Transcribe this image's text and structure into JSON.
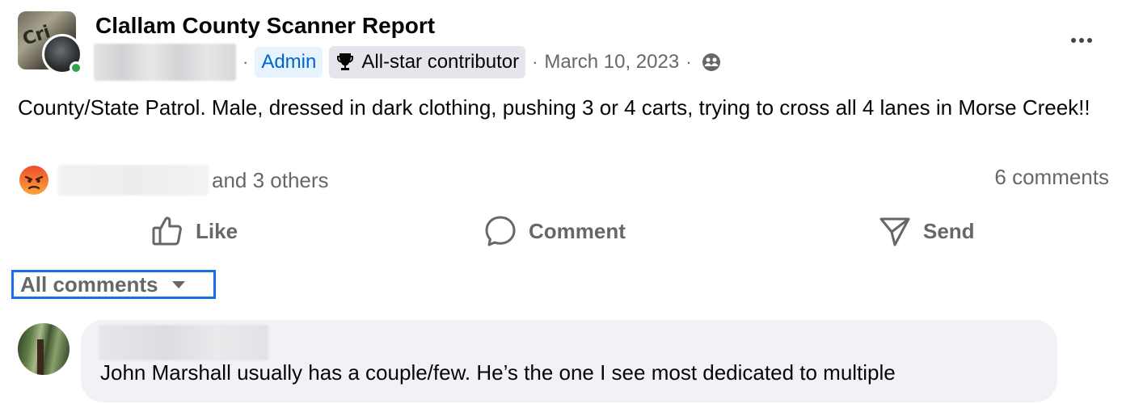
{
  "post": {
    "group_name": "Clallam County Scanner Report",
    "author_badges": {
      "admin": "Admin",
      "contributor": "All-star contributor"
    },
    "date": "March 10, 2023",
    "separator": "·",
    "text": "County/State Patrol. Male, dressed in dark clothing, pushing 3 or 4 carts, trying to cross all 4 lanes in Morse Creek!!",
    "avatar_text": "Cri",
    "icons": {
      "more": "more-options-icon",
      "privacy": "group-members-icon",
      "badge": "trophy-icon"
    }
  },
  "reactions": {
    "others_text": "and 3 others",
    "comments_count_text": "6 comments",
    "reaction_type": "angry"
  },
  "actions": {
    "like": "Like",
    "comment": "Comment",
    "send": "Send"
  },
  "comments_filter": {
    "label": "All comments"
  },
  "comments": [
    {
      "text": "John Marshall usually has a couple/few. He’s the one I see most dedicated to multiple"
    }
  ],
  "colors": {
    "admin_badge_bg": "#e7f3ff",
    "admin_badge_text": "#0064d1",
    "secondary_text": "#65676b",
    "filter_outline": "#1a6ee6",
    "comment_bubble": "#f0f2f5",
    "online": "#31a24c"
  }
}
